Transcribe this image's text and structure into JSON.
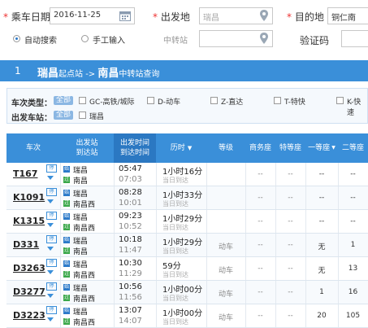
{
  "search": {
    "date_label": "乘车日期",
    "date_value": "2016-11-25",
    "from_label": "出发地",
    "from_value": "瑞昌",
    "to_label": "目的地",
    "to_value": "铜仁南",
    "mode_auto": "自动搜索",
    "mode_manual": "手工输入",
    "transfer_label": "中转站",
    "captcha_label": "验证码"
  },
  "banner": {
    "number": "1",
    "from": "瑞昌",
    "from_suffix": "起点站",
    "arrow": " -> ",
    "to": "南昌",
    "to_suffix": "中转站查询"
  },
  "filter": {
    "type_label": "车次类型：",
    "all": "全部",
    "types": [
      "GC-高铁/城际",
      "D-动车",
      "Z-直达",
      "T-特快",
      "K-快速"
    ],
    "station_label": "出发车站：",
    "stations": [
      "瑞昌"
    ]
  },
  "table": {
    "headers": {
      "train": "车次",
      "stations_1": "出发站",
      "stations_2": "到达站",
      "time_1": "出发时间",
      "time_2": "到达时间",
      "duration": "历时",
      "grade": "等级",
      "business": "商务座",
      "special": "特等座",
      "first": "一等座",
      "second": "二等座"
    },
    "rows": [
      {
        "train": "T167",
        "from": "瑞昌",
        "to": "南昌",
        "dep": "05:47",
        "arr": "07:03",
        "dur": "1小时16分",
        "same": "当日到达",
        "grade": "",
        "business": "--",
        "special": "--",
        "first": "--",
        "second": "--"
      },
      {
        "train": "K1091",
        "from": "瑞昌",
        "to": "南昌西",
        "dep": "08:28",
        "arr": "10:01",
        "dur": "1小时33分",
        "same": "当日到达",
        "grade": "",
        "business": "--",
        "special": "--",
        "first": "--",
        "second": "--"
      },
      {
        "train": "K1315",
        "from": "瑞昌",
        "to": "南昌西",
        "dep": "09:23",
        "arr": "10:52",
        "dur": "1小时29分",
        "same": "当日到达",
        "grade": "",
        "business": "--",
        "special": "--",
        "first": "--",
        "second": "--"
      },
      {
        "train": "D331",
        "from": "瑞昌",
        "to": "南昌",
        "dep": "10:18",
        "arr": "11:47",
        "dur": "1小时29分",
        "same": "当日到达",
        "grade": "动车",
        "business": "--",
        "special": "--",
        "first": "无",
        "second": "1"
      },
      {
        "train": "D3263",
        "from": "瑞昌",
        "to": "南昌西",
        "dep": "10:30",
        "arr": "11:29",
        "dur": "59分",
        "same": "当日到达",
        "grade": "动车",
        "business": "--",
        "special": "--",
        "first": "无",
        "second": "13"
      },
      {
        "train": "D3277",
        "from": "瑞昌",
        "to": "南昌西",
        "dep": "10:56",
        "arr": "11:56",
        "dur": "1小时00分",
        "same": "当日到达",
        "grade": "动车",
        "business": "--",
        "special": "--",
        "first": "1",
        "second": "16"
      },
      {
        "train": "D3223",
        "from": "瑞昌",
        "to": "南昌西",
        "dep": "13:07",
        "arr": "14:07",
        "dur": "1小时00分",
        "same": "当日到达",
        "grade": "动车",
        "business": "--",
        "special": "--",
        "first": "20",
        "second": "105"
      }
    ]
  },
  "icons": {
    "calendar": "calendar-icon",
    "location": "location-pin-icon",
    "sort": "sort-down-icon"
  },
  "colors": {
    "header_blue": "#3a8fd9",
    "header_highlight": "#2b78c2",
    "required": "#e33333"
  }
}
